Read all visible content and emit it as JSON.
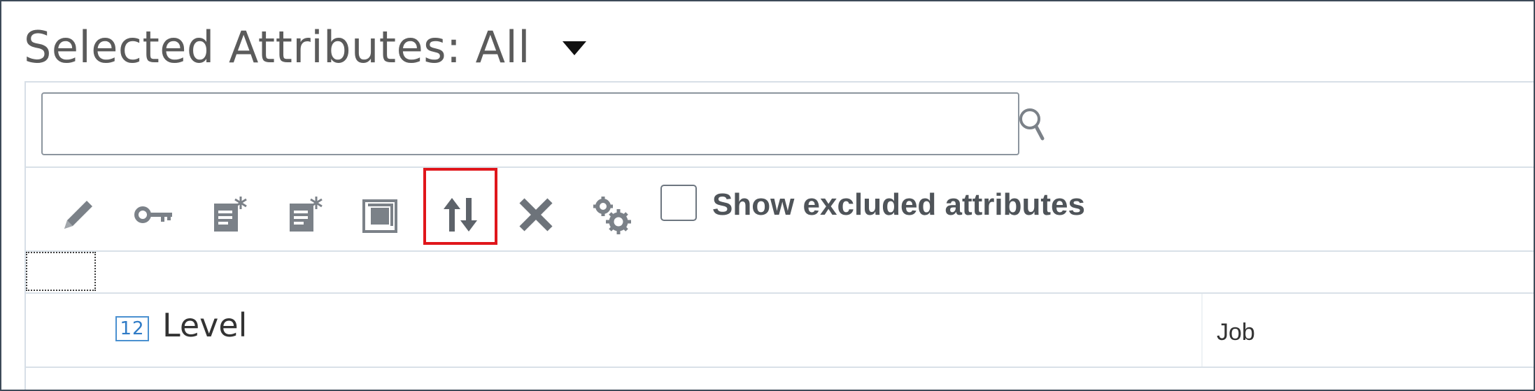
{
  "header": {
    "title": "Selected Attributes: All"
  },
  "search": {
    "value": "",
    "placeholder": ""
  },
  "toolbar": {
    "buttons": [
      {
        "name": "edit",
        "icon": "pencil-icon"
      },
      {
        "name": "key",
        "icon": "key-icon"
      },
      {
        "name": "new-attribute",
        "icon": "new-document-icon"
      },
      {
        "name": "new-attribute-2",
        "icon": "new-document-icon"
      },
      {
        "name": "duplicate",
        "icon": "duplicate-icon"
      },
      {
        "name": "reorder",
        "icon": "sort-arrows-icon",
        "highlighted": true
      },
      {
        "name": "delete",
        "icon": "close-icon"
      },
      {
        "name": "settings",
        "icon": "gears-icon"
      }
    ],
    "show_excluded_label": "Show excluded attributes",
    "show_excluded_checked": false
  },
  "table": {
    "rows": [
      {
        "type_icon": "12",
        "name": "Level",
        "type": "Job"
      }
    ]
  },
  "colors": {
    "highlight": "#e0161b",
    "icon_gray": "#7b8188",
    "type_icon_blue": "#2f7bc6"
  }
}
